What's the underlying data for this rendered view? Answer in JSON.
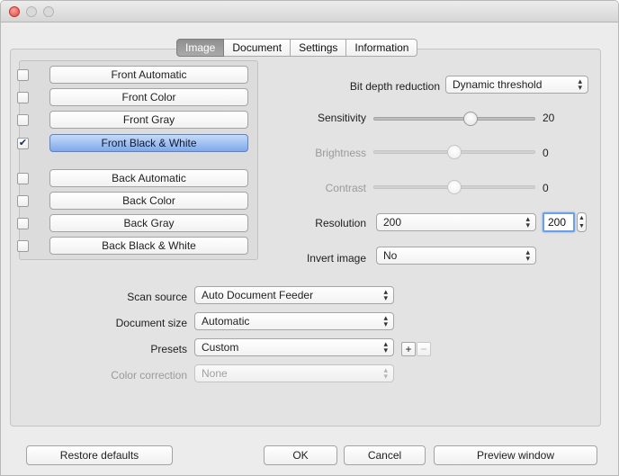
{
  "window": {
    "title": ""
  },
  "tabs": [
    {
      "label": "Image",
      "active": true
    },
    {
      "label": "Document",
      "active": false
    },
    {
      "label": "Settings",
      "active": false
    },
    {
      "label": "Information",
      "active": false
    }
  ],
  "modes": [
    {
      "label": "Front Automatic",
      "checked": false,
      "selected": false,
      "check_mark": ""
    },
    {
      "label": "Front Color",
      "checked": false,
      "selected": false,
      "check_mark": ""
    },
    {
      "label": "Front Gray",
      "checked": false,
      "selected": false,
      "check_mark": ""
    },
    {
      "label": "Front Black & White",
      "checked": true,
      "selected": true,
      "check_mark": "✔"
    },
    {
      "label": "Back Automatic",
      "checked": false,
      "selected": false,
      "check_mark": ""
    },
    {
      "label": "Back Color",
      "checked": false,
      "selected": false,
      "check_mark": ""
    },
    {
      "label": "Back Gray",
      "checked": false,
      "selected": false,
      "check_mark": ""
    },
    {
      "label": "Back Black & White",
      "checked": false,
      "selected": false,
      "check_mark": ""
    }
  ],
  "image_settings": {
    "bit_depth": {
      "label": "Bit depth reduction",
      "value": "Dynamic threshold"
    },
    "sensitivity": {
      "label": "Sensitivity",
      "value": "20",
      "level": 0.6,
      "enabled": true
    },
    "brightness": {
      "label": "Brightness",
      "value": "0",
      "level": 0.5,
      "enabled": false
    },
    "contrast": {
      "label": "Contrast",
      "value": "0",
      "level": 0.5,
      "enabled": false
    },
    "resolution": {
      "label": "Resolution",
      "value": "200",
      "field_value": "200"
    },
    "invert": {
      "label": "Invert image",
      "value": "No"
    }
  },
  "scan_settings": {
    "scan_source": {
      "label": "Scan source",
      "value": "Auto Document Feeder"
    },
    "document_size": {
      "label": "Document size",
      "value": "Automatic"
    },
    "presets": {
      "label": "Presets",
      "value": "Custom",
      "add_label": "+",
      "remove_label": "−"
    },
    "color_correction": {
      "label": "Color correction",
      "value": "None",
      "enabled": false
    }
  },
  "buttons": {
    "restore_defaults": "Restore defaults",
    "ok": "OK",
    "cancel": "Cancel",
    "preview_window": "Preview window"
  },
  "icons": {
    "popup_arrows": "⌃⌄",
    "stepper_arrows": "▲▼",
    "close": "close-icon",
    "minimize": "minimize-icon",
    "zoom": "zoom-icon"
  },
  "colors": {
    "selected_mode": "#7fa8ea",
    "focus_ring": "#6d9ee8",
    "close_button": "#e0443b"
  }
}
